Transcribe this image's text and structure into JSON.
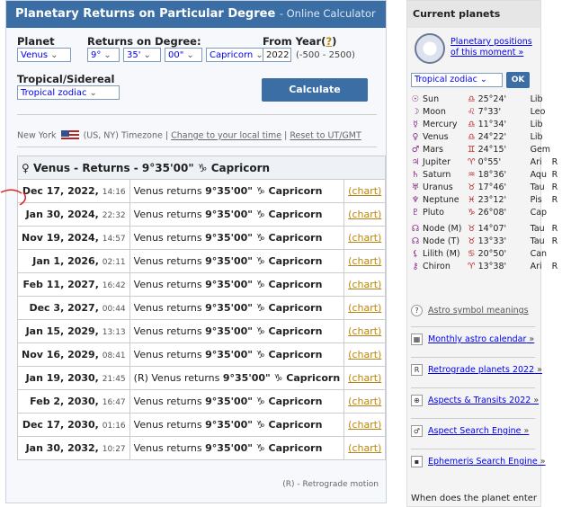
{
  "title": "Planetary Returns on Particular Degree",
  "subtitle": "- Online Calculator",
  "form": {
    "planet_label": "Planet",
    "planet_value": "Venus",
    "returns_label": "Returns on Degree:",
    "deg": "9°",
    "min": "35'",
    "sec": "00\"",
    "sign": "Capricorn",
    "year_label": "From Year(",
    "year_q": "?",
    "year_close": ")",
    "year_value": "2022",
    "year_range": "(-500 - 2500)",
    "zodiac_label": "Tropical/Sidereal",
    "zodiac_value": "Tropical zodiac",
    "calculate": "Calculate"
  },
  "timezone": {
    "city": "New York",
    "region": "(US, NY) Timezone |",
    "change": "Change to your local time",
    "sep": "|",
    "reset": "Reset to UT/GMT"
  },
  "table": {
    "header": "Venus - Returns - 9°35'00\" ♑ Capricorn",
    "rows": [
      {
        "date": "Dec 17, 2022,",
        "time": "14:16",
        "pre": "Venus returns ",
        "deg": "9°35'00\" ♑ Capricorn",
        "chart": "(chart)"
      },
      {
        "date": "Jan 30, 2024,",
        "time": "22:32",
        "pre": "Venus returns ",
        "deg": "9°35'00\" ♑ Capricorn",
        "chart": "(chart)"
      },
      {
        "date": "Nov 19, 2024,",
        "time": "14:57",
        "pre": "Venus returns ",
        "deg": "9°35'00\" ♑ Capricorn",
        "chart": "(chart)"
      },
      {
        "date": "Jan 1, 2026,",
        "time": "02:11",
        "pre": "Venus returns ",
        "deg": "9°35'00\" ♑ Capricorn",
        "chart": "(chart)"
      },
      {
        "date": "Feb 11, 2027,",
        "time": "16:42",
        "pre": "Venus returns ",
        "deg": "9°35'00\" ♑ Capricorn",
        "chart": "(chart)"
      },
      {
        "date": "Dec 3, 2027,",
        "time": "00:44",
        "pre": "Venus returns ",
        "deg": "9°35'00\" ♑ Capricorn",
        "chart": "(chart)"
      },
      {
        "date": "Jan 15, 2029,",
        "time": "13:13",
        "pre": "Venus returns ",
        "deg": "9°35'00\" ♑ Capricorn",
        "chart": "(chart)"
      },
      {
        "date": "Nov 16, 2029,",
        "time": "08:41",
        "pre": "Venus returns ",
        "deg": "9°35'00\" ♑ Capricorn",
        "chart": "(chart)"
      },
      {
        "date": "Jan 19, 2030,",
        "time": "21:45",
        "pre": "(R) Venus returns ",
        "deg": "9°35'00\" ♑ Capricorn",
        "chart": "(chart)"
      },
      {
        "date": "Feb 2, 2030,",
        "time": "16:47",
        "pre": "Venus returns ",
        "deg": "9°35'00\" ♑ Capricorn",
        "chart": "(chart)"
      },
      {
        "date": "Dec 17, 2030,",
        "time": "01:16",
        "pre": "Venus returns ",
        "deg": "9°35'00\" ♑ Capricorn",
        "chart": "(chart)"
      },
      {
        "date": "Jan 30, 2032,",
        "time": "10:27",
        "pre": "Venus returns ",
        "deg": "9°35'00\" ♑ Capricorn",
        "chart": "(chart)"
      }
    ],
    "footnote": "(R) - Retrograde motion"
  },
  "sidebar": {
    "title": "Current planets",
    "positions_link": "Planetary positions of this moment »",
    "zodiac": "Tropical zodiac",
    "ok": "OK",
    "planets": [
      {
        "g": "☉",
        "name": "Sun",
        "sg": "♎",
        "pos": "25°24'",
        "sign": "Lib",
        "r": ""
      },
      {
        "g": "☽",
        "name": "Moon",
        "sg": "♌",
        "pos": "7°33'",
        "sign": "Leo",
        "r": ""
      },
      {
        "g": "☿",
        "name": "Mercury",
        "sg": "♎",
        "pos": "11°34'",
        "sign": "Lib",
        "r": ""
      },
      {
        "g": "♀",
        "name": "Venus",
        "sg": "♎",
        "pos": "24°22'",
        "sign": "Lib",
        "r": ""
      },
      {
        "g": "♂",
        "name": "Mars",
        "sg": "♊",
        "pos": "24°15'",
        "sign": "Gem",
        "r": ""
      },
      {
        "g": "♃",
        "name": "Jupiter",
        "sg": "♈",
        "pos": "0°55'",
        "sign": "Ari",
        "r": "R"
      },
      {
        "g": "♄",
        "name": "Saturn",
        "sg": "♒",
        "pos": "18°36'",
        "sign": "Aqu",
        "r": "R"
      },
      {
        "g": "♅",
        "name": "Uranus",
        "sg": "♉",
        "pos": "17°46'",
        "sign": "Tau",
        "r": "R"
      },
      {
        "g": "♆",
        "name": "Neptune",
        "sg": "♓",
        "pos": "23°12'",
        "sign": "Pis",
        "r": "R"
      },
      {
        "g": "♇",
        "name": "Pluto",
        "sg": "♑",
        "pos": "26°08'",
        "sign": "Cap",
        "r": ""
      },
      {
        "g": "☊",
        "name": "Node (M)",
        "sg": "♉",
        "pos": "14°07'",
        "sign": "Tau",
        "r": "R"
      },
      {
        "g": "☊",
        "name": "Node (T)",
        "sg": "♉",
        "pos": "13°33'",
        "sign": "Tau",
        "r": "R"
      },
      {
        "g": "⚸",
        "name": "Lilith (M)",
        "sg": "♋",
        "pos": "20°50'",
        "sign": "Can",
        "r": ""
      },
      {
        "g": "⚷",
        "name": "Chiron",
        "sg": "♈",
        "pos": "13°38'",
        "sign": "Ari",
        "r": "R"
      }
    ],
    "astro_symbols": "Astro symbol meanings",
    "links": [
      "Monthly astro calendar",
      "Retrograde planets 2022",
      "Aspects & Transits 2022",
      "Aspect Search Engine",
      "Ephemeris Search Engine"
    ],
    "question": "When does the planet enter"
  }
}
